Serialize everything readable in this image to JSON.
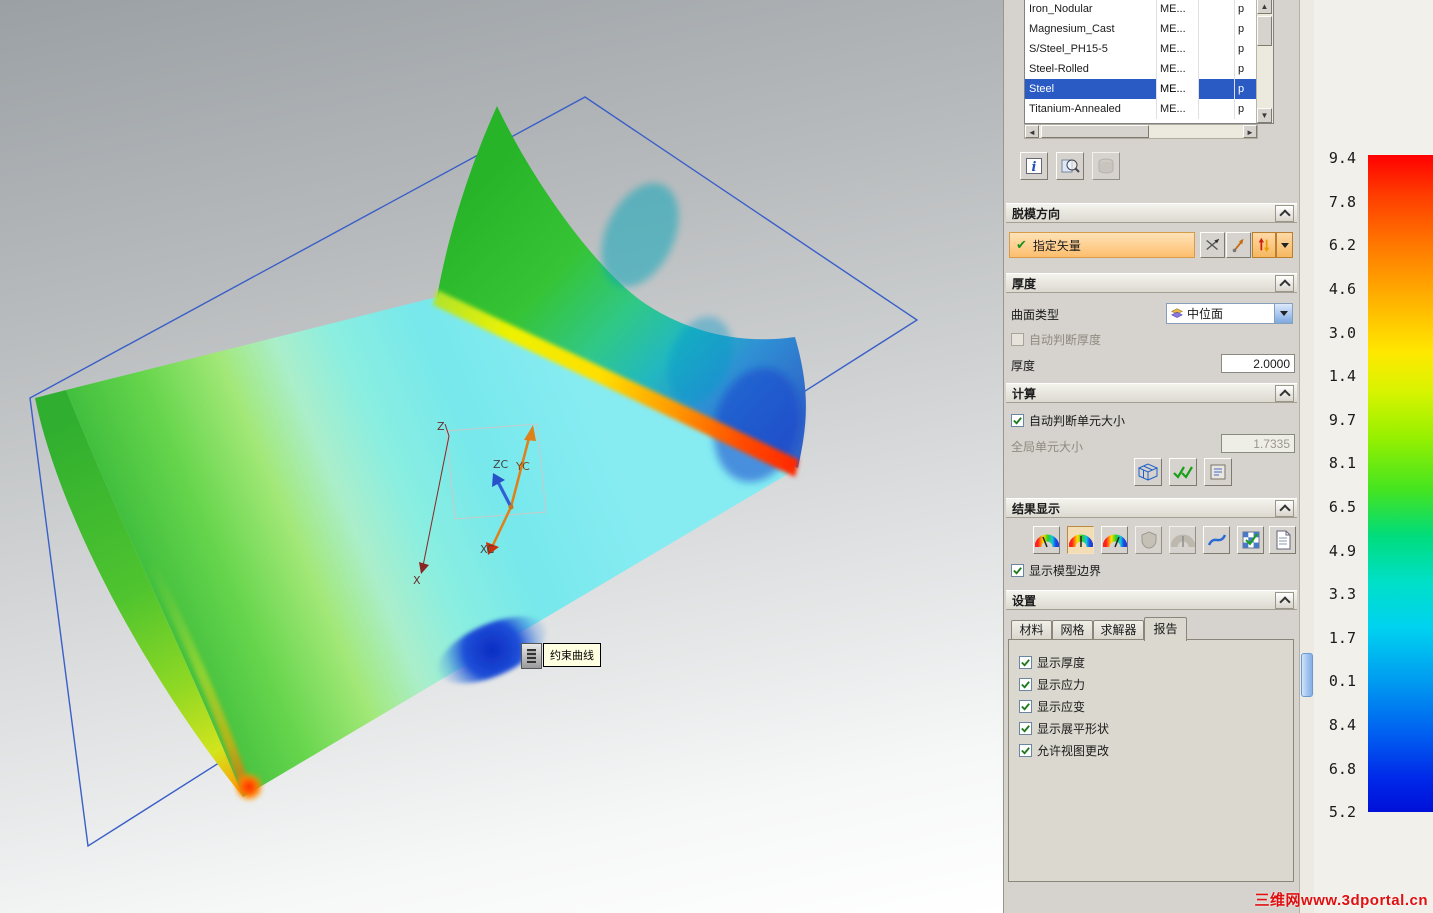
{
  "viewport": {
    "tooltip_label": "约束曲线",
    "axes": {
      "z": "Z",
      "x": "X",
      "yc": "YC",
      "zc": "ZC",
      "xc": "XC"
    }
  },
  "materials": {
    "rows": [
      {
        "name": "Iron_Nodular",
        "type": "ME...",
        "extra": "p"
      },
      {
        "name": "Magnesium_Cast",
        "type": "ME...",
        "extra": "p"
      },
      {
        "name": "S/Steel_PH15-5",
        "type": "ME...",
        "extra": "p"
      },
      {
        "name": "Steel-Rolled",
        "type": "ME...",
        "extra": "p"
      },
      {
        "name": "Steel",
        "type": "ME...",
        "extra": "p"
      },
      {
        "name": "Titanium-Annealed",
        "type": "ME...",
        "extra": "p"
      }
    ],
    "selected_row": "Steel"
  },
  "demold": {
    "title": "脱模方向",
    "vector_value": "指定矢量"
  },
  "thickness": {
    "title": "厚度",
    "surface_type_label": "曲面类型",
    "surface_type_value": "中位面",
    "auto_check_label": "自动判断厚度",
    "field_label": "厚度",
    "field_value": "2.0000"
  },
  "compute": {
    "title": "计算",
    "auto_elem_label": "自动判断单元大小",
    "global_elem_label": "全局单元大小",
    "global_elem_value": "1.7335"
  },
  "results": {
    "title": "结果显示",
    "boundary_label": "显示模型边界"
  },
  "settings": {
    "title": "设置",
    "tabs": [
      "材料",
      "网格",
      "求解器",
      "报告"
    ],
    "active_tab": "报告",
    "options": [
      "显示厚度",
      "显示应力",
      "显示应变",
      "显示展平形状",
      "允许视图更改"
    ]
  },
  "colorbar": {
    "labels": [
      "9.4",
      "7.8",
      "6.2",
      "4.6",
      "3.0",
      "1.4",
      "9.7",
      "8.1",
      "6.5",
      "4.9",
      "3.3",
      "1.7",
      "0.1",
      "8.4",
      "6.8",
      "5.2"
    ]
  },
  "icons": {
    "check": "✔",
    "info": "i",
    "scroll_up": "▲",
    "scroll_down": "▼",
    "scroll_left": "◄",
    "scroll_right": "►"
  },
  "watermark": "三维网www.3dportal.cn"
}
